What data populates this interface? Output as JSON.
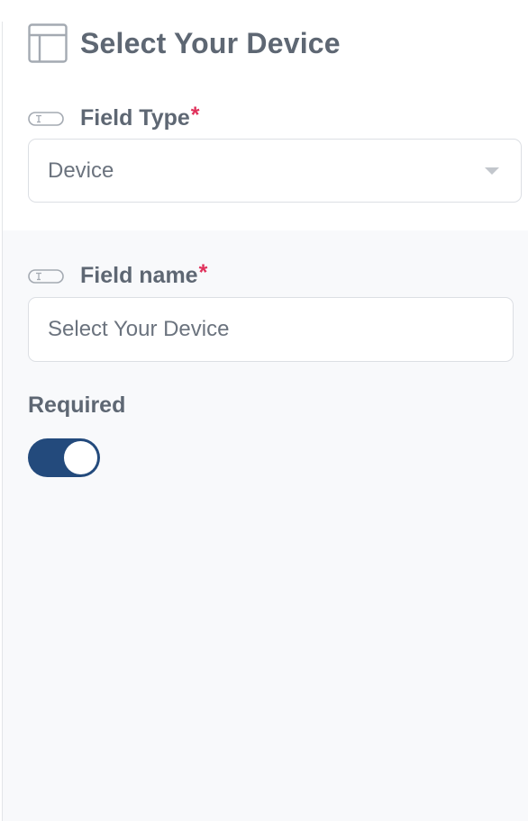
{
  "header": {
    "title": "Select Your Device",
    "icon": "layout-panel-icon"
  },
  "field_type": {
    "label": "Field Type",
    "required_mark": "*",
    "icon": "text-field-pill-icon",
    "selected_value": "Device"
  },
  "field_name": {
    "label": "Field name",
    "required_mark": "*",
    "icon": "text-field-pill-icon",
    "value": "Select Your Device"
  },
  "required": {
    "label": "Required",
    "enabled": true
  },
  "colors": {
    "accent": "#234a7c",
    "required_star": "#e0315b",
    "label_text": "#5e6773",
    "section_background": "#f8f9fb"
  }
}
